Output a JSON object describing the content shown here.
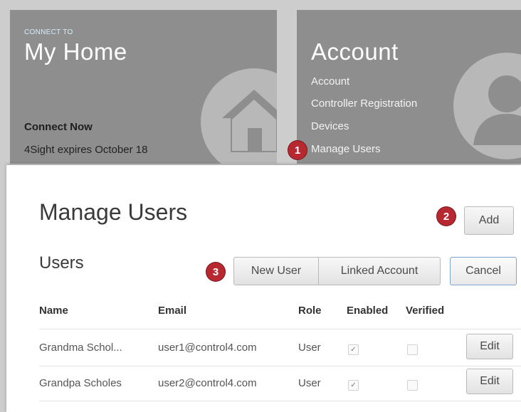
{
  "home_tile": {
    "kicker": "CONNECT TO",
    "title": "My Home",
    "link_label": "Connect Now",
    "status": "4Sight expires October 18",
    "icon": "house-icon"
  },
  "account_tile": {
    "title": "Account",
    "links": [
      "Account",
      "Controller Registration",
      "Devices",
      "Manage Users"
    ],
    "icon": "person-icon"
  },
  "callouts": [
    "1",
    "2",
    "3"
  ],
  "panel": {
    "title": "Manage Users",
    "section_title": "Users",
    "add_label": "Add",
    "new_user_label": "New User",
    "linked_account_label": "Linked Account",
    "cancel_label": "Cancel"
  },
  "table": {
    "columns": [
      "Name",
      "Email",
      "Role",
      "Enabled",
      "Verified"
    ],
    "rows": [
      {
        "name": "Grandma Schol...",
        "email": "user1@control4.com",
        "role": "User",
        "enabled": true,
        "verified": false,
        "edit_label": "Edit"
      },
      {
        "name": "Grandpa Scholes",
        "email": "user2@control4.com",
        "role": "User",
        "enabled": true,
        "verified": false,
        "edit_label": "Edit"
      }
    ]
  },
  "colors": {
    "tile_bg": "#8e8e8e",
    "badge": "#b72830",
    "kicker": "#d8eefc"
  }
}
